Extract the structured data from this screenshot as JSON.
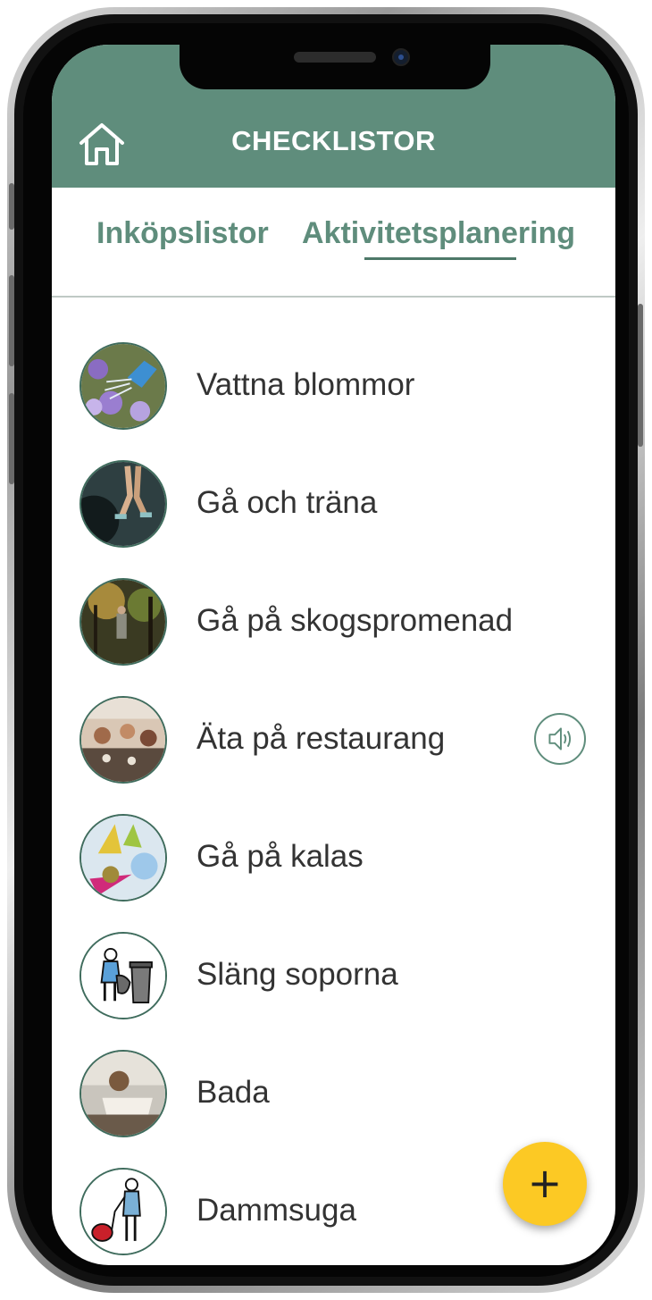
{
  "header": {
    "title": "CHECKLISTOR",
    "home_icon": "home-icon",
    "color": "#5f8d7c"
  },
  "tabs": [
    {
      "label": "Inköpslistor",
      "selected": false
    },
    {
      "label": "Aktivitetsplanering",
      "selected": true
    }
  ],
  "activities": [
    {
      "label": "Vattna blommor",
      "icon": "watering-flowers-photo"
    },
    {
      "label": "Gå och träna",
      "icon": "gym-workout-photo"
    },
    {
      "label": "Gå på skogspromenad",
      "icon": "forest-walk-photo"
    },
    {
      "label": "Äta på restaurang",
      "icon": "restaurant-dinner-photo",
      "speaker_icon": "speaker-icon"
    },
    {
      "label": "Gå på kalas",
      "icon": "party-photo"
    },
    {
      "label": "Släng soporna",
      "icon": "trash-pictogram"
    },
    {
      "label": "Bada",
      "icon": "bath-photo"
    },
    {
      "label": "Dammsuga",
      "icon": "vacuum-pictogram"
    }
  ],
  "fab": {
    "label": "+",
    "icon": "plus-icon",
    "color": "#fcc924"
  }
}
